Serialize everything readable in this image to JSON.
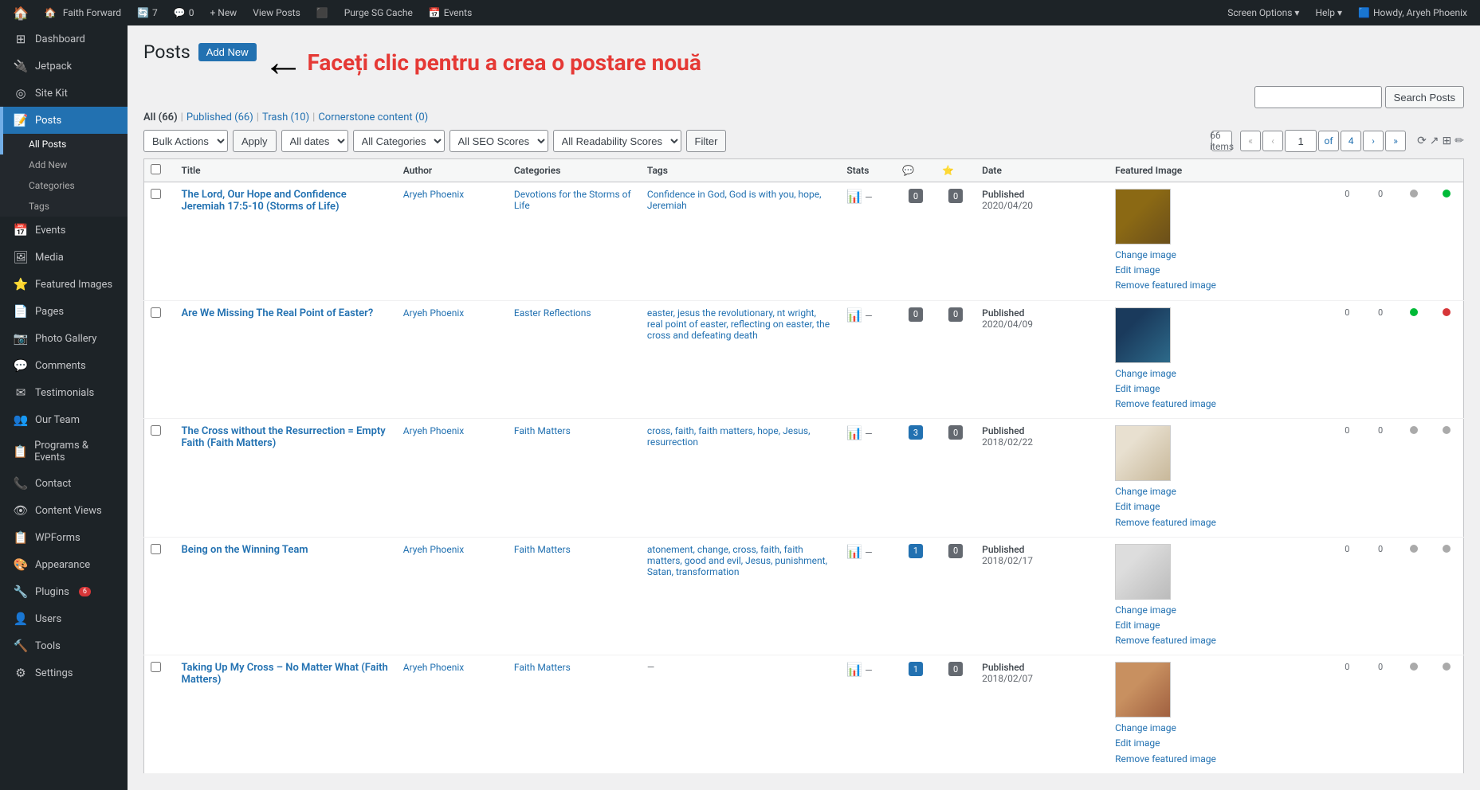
{
  "adminbar": {
    "site_icon": "🏠",
    "site_name": "Faith Forward",
    "updates": "7",
    "comments": "0",
    "new_label": "+ New",
    "view_posts": "View Posts",
    "purge_cache": "Purge SG Cache",
    "events": "Events",
    "howdy": "Howdy, Aryeh Phoenix",
    "screen_options": "Screen Options ▾",
    "help": "Help ▾"
  },
  "sidebar": {
    "items": [
      {
        "id": "dashboard",
        "icon": "⊞",
        "label": "Dashboard"
      },
      {
        "id": "jetpack",
        "icon": "🔌",
        "label": "Jetpack"
      },
      {
        "id": "sitekit",
        "icon": "◎",
        "label": "Site Kit"
      },
      {
        "id": "posts",
        "icon": "📝",
        "label": "Posts",
        "active": true
      },
      {
        "id": "events",
        "icon": "📅",
        "label": "Events"
      },
      {
        "id": "media",
        "icon": "🖼",
        "label": "Media"
      },
      {
        "id": "featured-images",
        "icon": "⭐",
        "label": "Featured Images"
      },
      {
        "id": "pages",
        "icon": "📄",
        "label": "Pages"
      },
      {
        "id": "photo-gallery",
        "icon": "📷",
        "label": "Photo Gallery"
      },
      {
        "id": "comments",
        "icon": "💬",
        "label": "Comments"
      },
      {
        "id": "testimonials",
        "icon": "✉",
        "label": "Testimonials"
      },
      {
        "id": "our-team",
        "icon": "👥",
        "label": "Our Team"
      },
      {
        "id": "programs",
        "icon": "📋",
        "label": "Programs & Events"
      },
      {
        "id": "contact",
        "icon": "📞",
        "label": "Contact"
      },
      {
        "id": "content-views",
        "icon": "👁",
        "label": "Content Views"
      },
      {
        "id": "wpforms",
        "icon": "📋",
        "label": "WPForms"
      },
      {
        "id": "appearance",
        "icon": "🎨",
        "label": "Appearance"
      },
      {
        "id": "plugins",
        "icon": "🔧",
        "label": "Plugins",
        "badge": "6"
      },
      {
        "id": "users",
        "icon": "👤",
        "label": "Users"
      },
      {
        "id": "tools",
        "icon": "🔨",
        "label": "Tools"
      },
      {
        "id": "settings",
        "icon": "⚙",
        "label": "Settings"
      }
    ],
    "posts_submenu": [
      {
        "id": "all-posts",
        "label": "All Posts",
        "active": true
      },
      {
        "id": "add-new",
        "label": "Add New"
      },
      {
        "id": "categories",
        "label": "Categories"
      },
      {
        "id": "tags",
        "label": "Tags"
      }
    ]
  },
  "page": {
    "title": "Posts",
    "add_new_label": "Add New",
    "annotation": "Faceți clic pentru a crea o postare nouă"
  },
  "filter_links": {
    "all": "All",
    "all_count": "66",
    "published": "Published",
    "published_count": "66",
    "trash": "Trash",
    "trash_count": "10",
    "cornerstone": "Cornerstone content",
    "cornerstone_count": "0"
  },
  "toolbar": {
    "bulk_actions": "Bulk Actions",
    "apply": "Apply",
    "all_dates": "All dates",
    "all_categories": "All Categories",
    "all_seo": "All SEO Scores",
    "all_readability": "All Readability Scores",
    "filter": "Filter",
    "items_count": "66 items",
    "page_current": "1",
    "page_total": "4",
    "search_placeholder": "",
    "search_btn": "Search Posts"
  },
  "table": {
    "columns": {
      "title": "Title",
      "author": "Author",
      "categories": "Categories",
      "tags": "Tags",
      "stats": "Stats",
      "date": "Date",
      "featured_image": "Featured Image"
    },
    "rows": [
      {
        "id": 1,
        "title": "The Lord, Our Hope and Confidence Jeremiah 17:5-10 (Storms of Life)",
        "author": "Aryeh Phoenix",
        "categories": "Devotions for the Storms of Life",
        "tags": "Confidence in God, God is with you, hope, Jeremiah",
        "comments": "0",
        "has_comments": false,
        "published_label": "Published",
        "date": "2020/04/20",
        "thumb_class": "thumb-1",
        "seo_color": "gray",
        "readability_color": "green",
        "score1": "0",
        "score2": "0"
      },
      {
        "id": 2,
        "title": "Are We Missing The Real Point of Easter?",
        "author": "Aryeh Phoenix",
        "categories": "Easter Reflections",
        "tags": "easter, jesus the revolutionary, nt wright, real point of easter, reflecting on easter, the cross and defeating death",
        "comments": "0",
        "has_comments": false,
        "published_label": "Published",
        "date": "2020/04/09",
        "thumb_class": "thumb-2",
        "seo_color": "green",
        "readability_color": "red",
        "score1": "0",
        "score2": "0"
      },
      {
        "id": 3,
        "title": "The Cross without the Resurrection = Empty Faith (Faith Matters)",
        "author": "Aryeh Phoenix",
        "categories": "Faith Matters",
        "tags": "cross, faith, faith matters, hope, Jesus, resurrection",
        "comments": "3",
        "has_comments": true,
        "published_label": "Published",
        "date": "2018/02/22",
        "thumb_class": "thumb-3",
        "seo_color": "gray",
        "readability_color": "gray",
        "score1": "0",
        "score2": "0"
      },
      {
        "id": 4,
        "title": "Being on the Winning Team",
        "author": "Aryeh Phoenix",
        "categories": "Faith Matters",
        "tags": "atonement, change, cross, faith, faith matters, good and evil, Jesus, punishment, Satan, transformation",
        "comments": "1",
        "has_comments": true,
        "published_label": "Published",
        "date": "2018/02/17",
        "thumb_class": "thumb-4",
        "seo_color": "gray",
        "readability_color": "gray",
        "score1": "0",
        "score2": "0"
      },
      {
        "id": 5,
        "title": "Taking Up My Cross – No Matter What (Faith Matters)",
        "author": "Aryeh Phoenix",
        "categories": "Faith Matters",
        "tags": "—",
        "comments": "1",
        "has_comments": true,
        "published_label": "Published",
        "date": "2018/02/07",
        "thumb_class": "thumb-5",
        "seo_color": "gray",
        "readability_color": "gray",
        "score1": "0",
        "score2": "0"
      }
    ]
  }
}
